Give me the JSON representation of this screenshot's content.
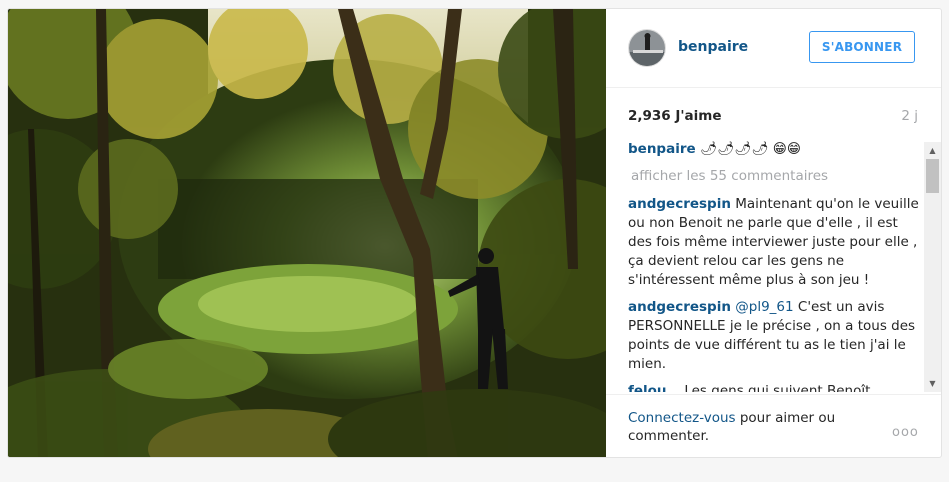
{
  "post": {
    "author": "benpaire",
    "follow_label": "S'ABONNER",
    "likes": "2,936 J'aime",
    "age": "2 j",
    "caption_user": "benpaire",
    "caption_text": "🌶🌶🌶🌶 😁😁",
    "more_comments": "afficher les 55 commentaires"
  },
  "comments": [
    {
      "user": "andgecrespin",
      "mention": "",
      "text": "Maintenant qu'on le veuille ou non Benoit ne parle que d'elle , il est des fois même interviewer juste pour elle , ça devient relou car les gens ne s'intéressent même plus à son jeu !"
    },
    {
      "user": "andgecrespin",
      "mention": "@pl9_61",
      "text": "C'est un avis PERSONNELLE je le précise , on a tous des points de vue différent tu as le tien j'ai le mien."
    },
    {
      "user": "felou__",
      "mention": "",
      "text": "Les gens qui suivent Benoît"
    }
  ],
  "footer": {
    "login_link": "Connectez-vous",
    "login_text": " pour aimer ou commenter.",
    "more_label": "ooo"
  },
  "icons": {
    "scroll_up": "scroll-up-arrow-icon",
    "scroll_down": "scroll-down-arrow-icon"
  }
}
